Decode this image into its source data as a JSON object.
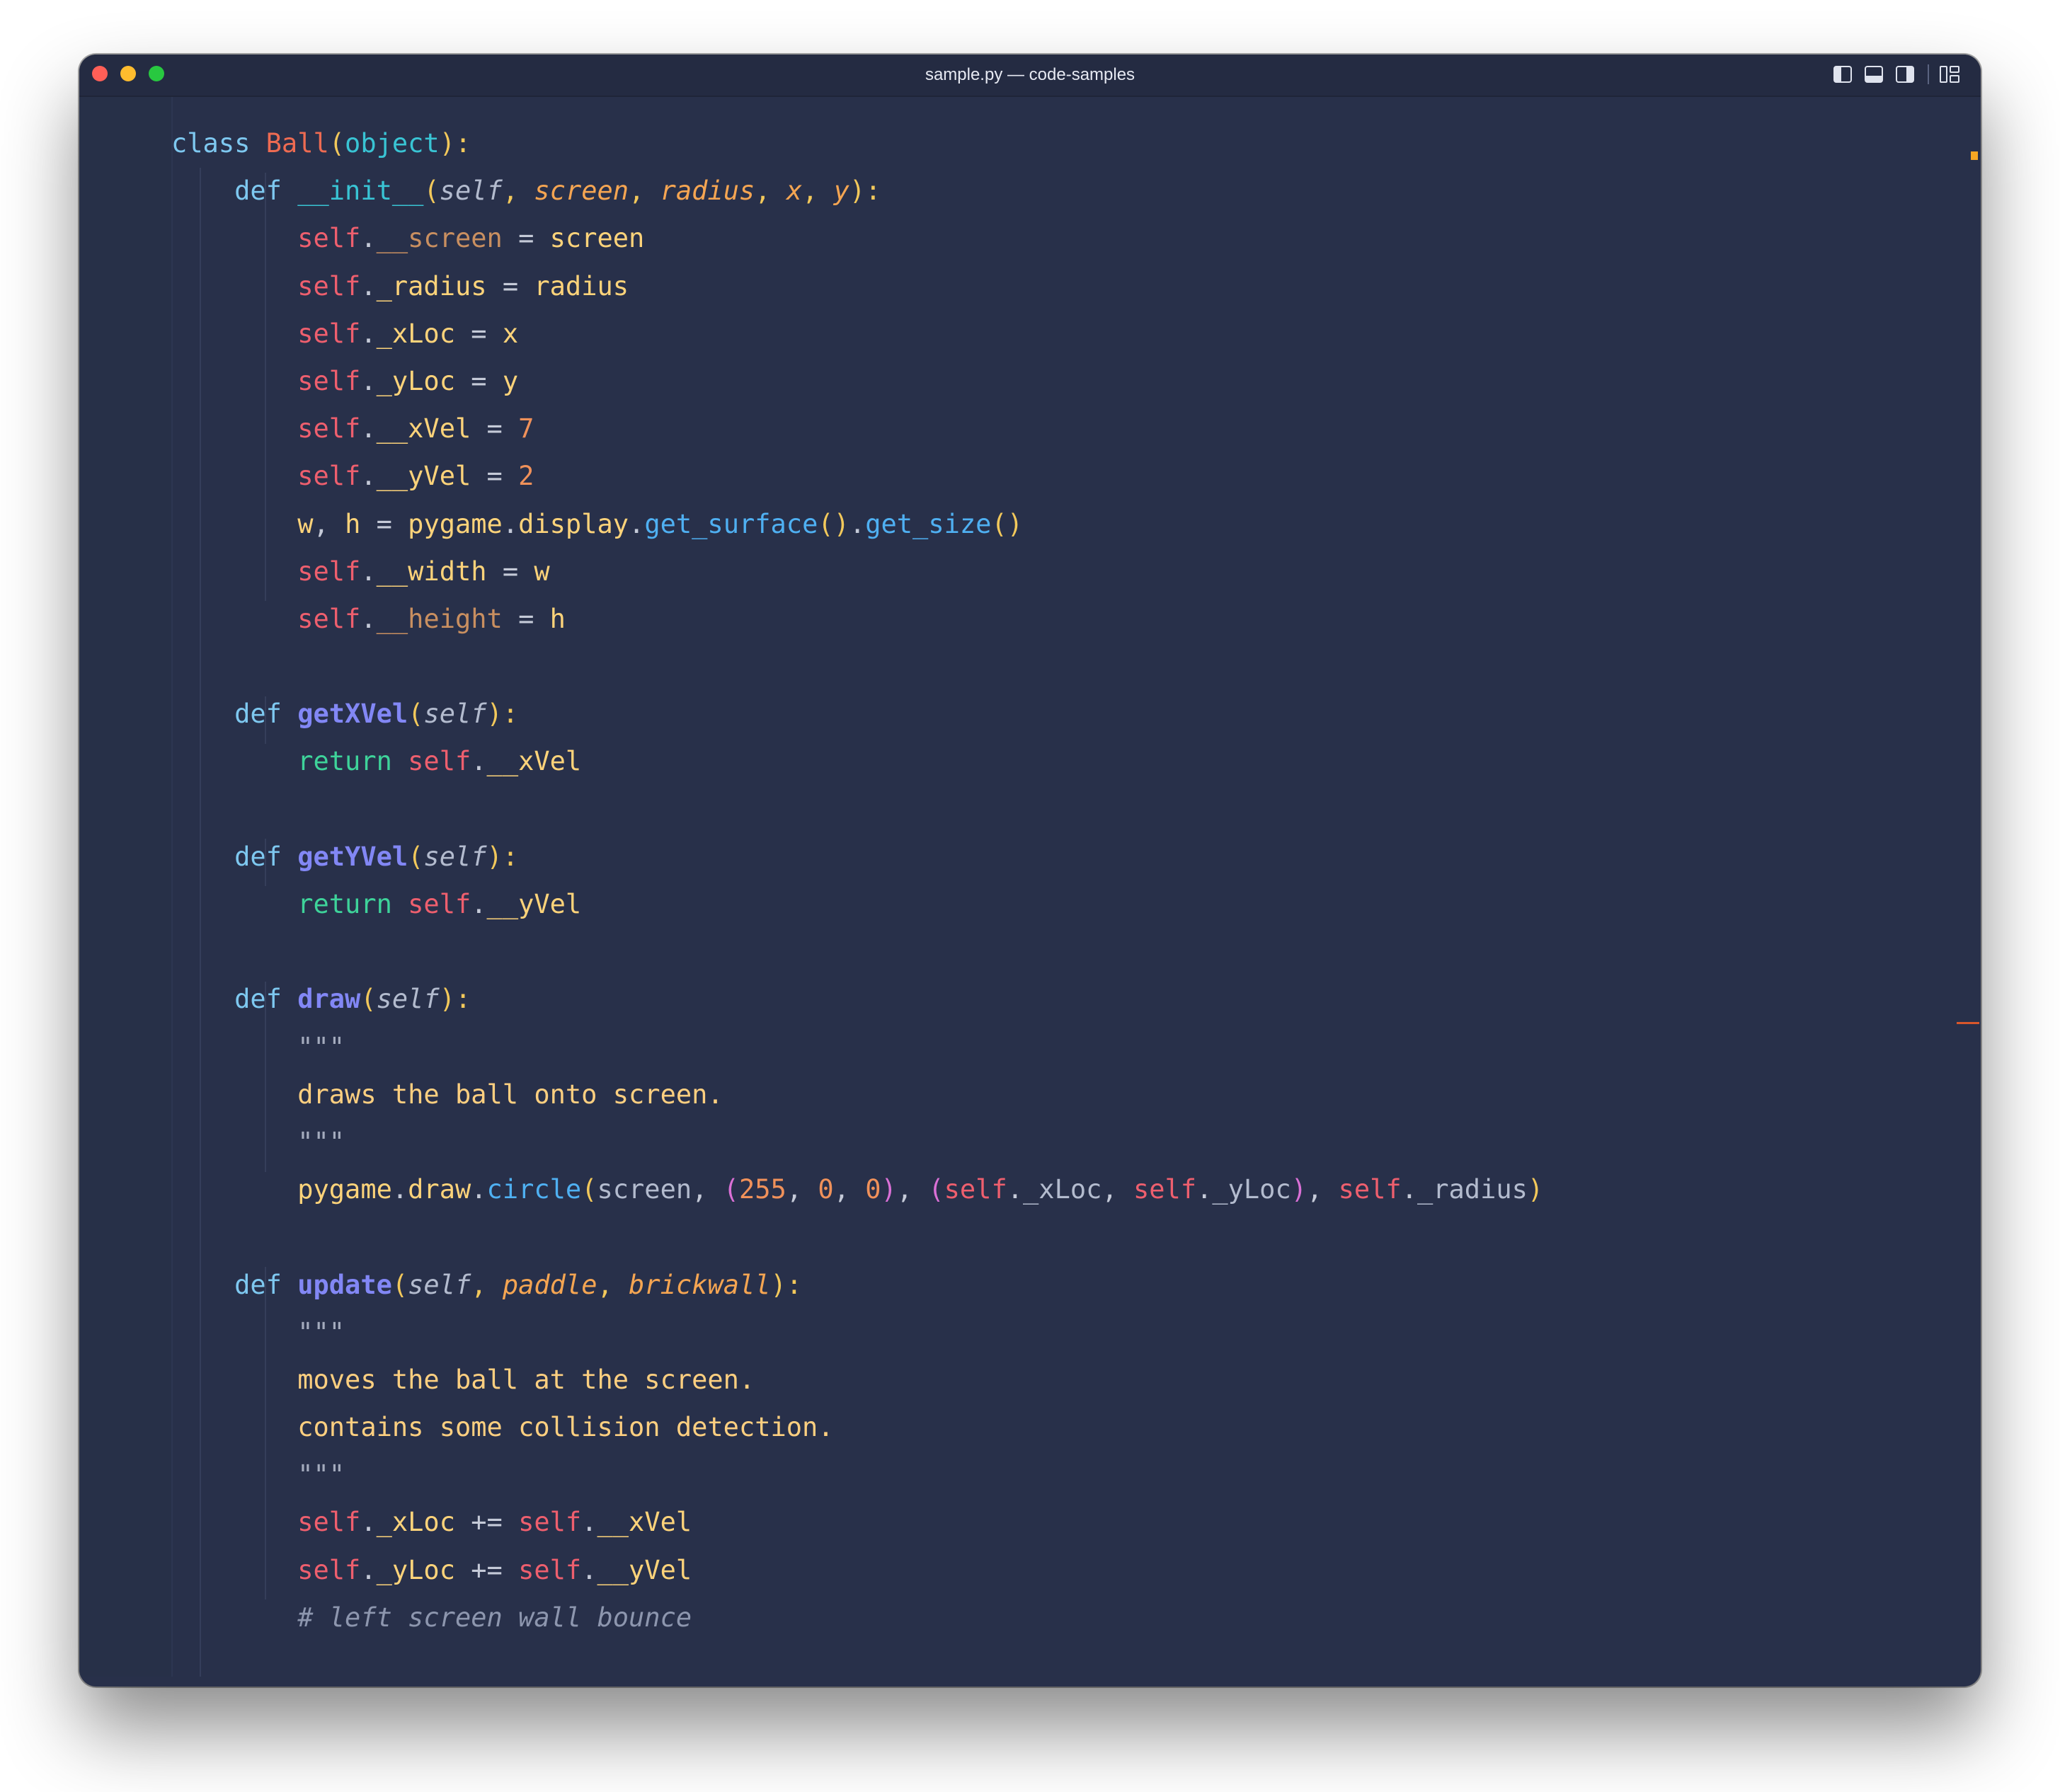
{
  "window": {
    "title": "sample.py — code-samples"
  },
  "colors": {
    "editor_bg": "#28304a",
    "titlebar_bg": "#242b42",
    "traffic_close": "#ff5f57",
    "traffic_minimize": "#febc2e",
    "traffic_zoom": "#28c840",
    "scroll_marker_orange": "#f5a623",
    "scroll_marker_red": "#d9572b"
  },
  "titlebar_icons": [
    "sidebar-left-layout-icon",
    "panel-bottom-layout-icon",
    "sidebar-right-layout-icon",
    "customize-layout-icon"
  ],
  "code_lines": [
    [
      [
        "class ",
        "#7ec8f0",
        ""
      ],
      [
        "Ball",
        "#ee6b52",
        ""
      ],
      [
        "(",
        "#f2c85b",
        ""
      ],
      [
        "object",
        "#39c4d4",
        ""
      ],
      [
        "):",
        "#f2c85b",
        ""
      ]
    ],
    [
      [
        "    "
      ],
      [
        "def ",
        "#7ec8f0",
        ""
      ],
      [
        "__init__",
        "#39c4d4",
        ""
      ],
      [
        "(",
        "#f2c85b",
        ""
      ],
      [
        "self",
        "#b3bbce",
        "it"
      ],
      [
        ", ",
        "#f2c85b",
        ""
      ],
      [
        "screen",
        "#f5a552",
        "it"
      ],
      [
        ", ",
        "#f2c85b",
        ""
      ],
      [
        "radius",
        "#f5a552",
        "it"
      ],
      [
        ", ",
        "#f2c85b",
        ""
      ],
      [
        "x",
        "#f5a552",
        "it"
      ],
      [
        ", ",
        "#f2c85b",
        ""
      ],
      [
        "y",
        "#f5a552",
        "it"
      ],
      [
        "):",
        "#f2c85b",
        ""
      ]
    ],
    [
      [
        "        "
      ],
      [
        "self",
        "#ee5f6e",
        ""
      ],
      [
        ".",
        "#c5cad8",
        ""
      ],
      [
        "__screen",
        "#c98f60",
        ""
      ],
      [
        " = ",
        "#c5cad8",
        ""
      ],
      [
        "screen",
        "#fdd37a",
        ""
      ]
    ],
    [
      [
        "        "
      ],
      [
        "self",
        "#ee5f6e",
        ""
      ],
      [
        ".",
        "#c5cad8",
        ""
      ],
      [
        "_radius",
        "#fdd37a",
        ""
      ],
      [
        " = ",
        "#c5cad8",
        ""
      ],
      [
        "radius",
        "#fdd37a",
        ""
      ]
    ],
    [
      [
        "        "
      ],
      [
        "self",
        "#ee5f6e",
        ""
      ],
      [
        ".",
        "#c5cad8",
        ""
      ],
      [
        "_xLoc",
        "#fdd37a",
        ""
      ],
      [
        " = ",
        "#c5cad8",
        ""
      ],
      [
        "x",
        "#fdd37a",
        ""
      ]
    ],
    [
      [
        "        "
      ],
      [
        "self",
        "#ee5f6e",
        ""
      ],
      [
        ".",
        "#c5cad8",
        ""
      ],
      [
        "_yLoc",
        "#fdd37a",
        ""
      ],
      [
        " = ",
        "#c5cad8",
        ""
      ],
      [
        "y",
        "#fdd37a",
        ""
      ]
    ],
    [
      [
        "        "
      ],
      [
        "self",
        "#ee5f6e",
        ""
      ],
      [
        ".",
        "#c5cad8",
        ""
      ],
      [
        "__xVel",
        "#fdd37a",
        ""
      ],
      [
        " = ",
        "#c5cad8",
        ""
      ],
      [
        "7",
        "#f0915a",
        ""
      ]
    ],
    [
      [
        "        "
      ],
      [
        "self",
        "#ee5f6e",
        ""
      ],
      [
        ".",
        "#c5cad8",
        ""
      ],
      [
        "__yVel",
        "#fdd37a",
        ""
      ],
      [
        " = ",
        "#c5cad8",
        ""
      ],
      [
        "2",
        "#f0915a",
        ""
      ]
    ],
    [
      [
        "        "
      ],
      [
        "w",
        "#fdd37a",
        ""
      ],
      [
        ", ",
        "#c5cad8",
        ""
      ],
      [
        "h",
        "#fdd37a",
        ""
      ],
      [
        " = ",
        "#c5cad8",
        ""
      ],
      [
        "pygame",
        "#fdd37a",
        ""
      ],
      [
        ".",
        "#c5cad8",
        ""
      ],
      [
        "display",
        "#fdd37a",
        ""
      ],
      [
        ".",
        "#c5cad8",
        ""
      ],
      [
        "get_surface",
        "#4fb0f2",
        ""
      ],
      [
        "()",
        "#f2c85b",
        ""
      ],
      [
        ".",
        "#c5cad8",
        ""
      ],
      [
        "get_size",
        "#4fb0f2",
        ""
      ],
      [
        "()",
        "#f2c85b",
        ""
      ]
    ],
    [
      [
        "        "
      ],
      [
        "self",
        "#ee5f6e",
        ""
      ],
      [
        ".",
        "#c5cad8",
        ""
      ],
      [
        "__width",
        "#fdd37a",
        ""
      ],
      [
        " = ",
        "#c5cad8",
        ""
      ],
      [
        "w",
        "#fdd37a",
        ""
      ]
    ],
    [
      [
        "        "
      ],
      [
        "self",
        "#ee5f6e",
        ""
      ],
      [
        ".",
        "#c5cad8",
        ""
      ],
      [
        "__height",
        "#c98f60",
        ""
      ],
      [
        " = ",
        "#c5cad8",
        ""
      ],
      [
        "h",
        "#fdd37a",
        ""
      ]
    ],
    [],
    [
      [
        "    "
      ],
      [
        "def ",
        "#7ec8f0",
        ""
      ],
      [
        "getXVel",
        "#8287f5",
        "b"
      ],
      [
        "(",
        "#f2c85b",
        ""
      ],
      [
        "self",
        "#b3bbce",
        "it"
      ],
      [
        "):",
        "#f2c85b",
        ""
      ]
    ],
    [
      [
        "        "
      ],
      [
        "return ",
        "#3ed39a",
        ""
      ],
      [
        "self",
        "#ee5f6e",
        ""
      ],
      [
        ".",
        "#c5cad8",
        ""
      ],
      [
        "__xVel",
        "#fdd37a",
        ""
      ]
    ],
    [],
    [
      [
        "    "
      ],
      [
        "def ",
        "#7ec8f0",
        ""
      ],
      [
        "getYVel",
        "#8287f5",
        "b"
      ],
      [
        "(",
        "#f2c85b",
        ""
      ],
      [
        "self",
        "#b3bbce",
        "it"
      ],
      [
        "):",
        "#f2c85b",
        ""
      ]
    ],
    [
      [
        "        "
      ],
      [
        "return ",
        "#3ed39a",
        ""
      ],
      [
        "self",
        "#ee5f6e",
        ""
      ],
      [
        ".",
        "#c5cad8",
        ""
      ],
      [
        "__yVel",
        "#fdd37a",
        ""
      ]
    ],
    [],
    [
      [
        "    "
      ],
      [
        "def ",
        "#7ec8f0",
        ""
      ],
      [
        "draw",
        "#8287f5",
        "b"
      ],
      [
        "(",
        "#f2c85b",
        ""
      ],
      [
        "self",
        "#b3bbce",
        "it"
      ],
      [
        "):",
        "#f2c85b",
        ""
      ]
    ],
    [
      [
        "        "
      ],
      [
        "\"\"\"",
        "#a4abbd",
        ""
      ]
    ],
    [
      [
        "        "
      ],
      [
        "draws the ball onto screen.",
        "#fdcf80",
        ""
      ]
    ],
    [
      [
        "        "
      ],
      [
        "\"\"\"",
        "#a4abbd",
        ""
      ]
    ],
    [
      [
        "        "
      ],
      [
        "pygame",
        "#fdd37a",
        ""
      ],
      [
        ".",
        "#c5cad8",
        ""
      ],
      [
        "draw",
        "#fdd37a",
        ""
      ],
      [
        ".",
        "#c5cad8",
        ""
      ],
      [
        "circle",
        "#4fb0f2",
        ""
      ],
      [
        "(",
        "#f2c85b",
        ""
      ],
      [
        "screen",
        "#b3bbce",
        ""
      ],
      [
        ", ",
        "#c5cad8",
        ""
      ],
      [
        "(",
        "#da70d6",
        ""
      ],
      [
        "255",
        "#f0915a",
        ""
      ],
      [
        ", ",
        "#c5cad8",
        ""
      ],
      [
        "0",
        "#f0915a",
        ""
      ],
      [
        ", ",
        "#c5cad8",
        ""
      ],
      [
        "0",
        "#f0915a",
        ""
      ],
      [
        ")",
        "#da70d6",
        ""
      ],
      [
        ", ",
        "#c5cad8",
        ""
      ],
      [
        "(",
        "#da70d6",
        ""
      ],
      [
        "self",
        "#ee5f6e",
        ""
      ],
      [
        ".",
        "#c5cad8",
        ""
      ],
      [
        "_xLoc",
        "#b3bbce",
        ""
      ],
      [
        ", ",
        "#c5cad8",
        ""
      ],
      [
        "self",
        "#ee5f6e",
        ""
      ],
      [
        ".",
        "#c5cad8",
        ""
      ],
      [
        "_yLoc",
        "#b3bbce",
        ""
      ],
      [
        ")",
        "#da70d6",
        ""
      ],
      [
        ", ",
        "#c5cad8",
        ""
      ],
      [
        "self",
        "#ee5f6e",
        ""
      ],
      [
        ".",
        "#c5cad8",
        ""
      ],
      [
        "_radius",
        "#b3bbce",
        ""
      ],
      [
        ")",
        "#f2c85b",
        ""
      ]
    ],
    [],
    [
      [
        "    "
      ],
      [
        "def ",
        "#7ec8f0",
        ""
      ],
      [
        "update",
        "#8287f5",
        "b"
      ],
      [
        "(",
        "#f2c85b",
        ""
      ],
      [
        "self",
        "#b3bbce",
        "it"
      ],
      [
        ", ",
        "#f2c85b",
        ""
      ],
      [
        "paddle",
        "#f5a552",
        "it"
      ],
      [
        ", ",
        "#f2c85b",
        ""
      ],
      [
        "brickwall",
        "#f5a552",
        "it"
      ],
      [
        "):",
        "#f2c85b",
        ""
      ]
    ],
    [
      [
        "        "
      ],
      [
        "\"\"\"",
        "#a4abbd",
        ""
      ]
    ],
    [
      [
        "        "
      ],
      [
        "moves the ball at the screen.",
        "#fdcf80",
        ""
      ]
    ],
    [
      [
        "        "
      ],
      [
        "contains some collision detection.",
        "#fdcf80",
        ""
      ]
    ],
    [
      [
        "        "
      ],
      [
        "\"\"\"",
        "#a4abbd",
        ""
      ]
    ],
    [
      [
        "        "
      ],
      [
        "self",
        "#ee5f6e",
        ""
      ],
      [
        ".",
        "#c5cad8",
        ""
      ],
      [
        "_xLoc",
        "#fdd37a",
        ""
      ],
      [
        " += ",
        "#c5cad8",
        ""
      ],
      [
        "self",
        "#ee5f6e",
        ""
      ],
      [
        ".",
        "#c5cad8",
        ""
      ],
      [
        "__xVel",
        "#fdd37a",
        ""
      ]
    ],
    [
      [
        "        "
      ],
      [
        "self",
        "#ee5f6e",
        ""
      ],
      [
        ".",
        "#c5cad8",
        ""
      ],
      [
        "_yLoc",
        "#fdd37a",
        ""
      ],
      [
        " += ",
        "#c5cad8",
        ""
      ],
      [
        "self",
        "#ee5f6e",
        ""
      ],
      [
        ".",
        "#c5cad8",
        ""
      ],
      [
        "__yVel",
        "#fdd37a",
        ""
      ]
    ],
    [
      [
        "        "
      ],
      [
        "# left screen wall bounce",
        "#8d96ae",
        "it"
      ]
    ]
  ]
}
